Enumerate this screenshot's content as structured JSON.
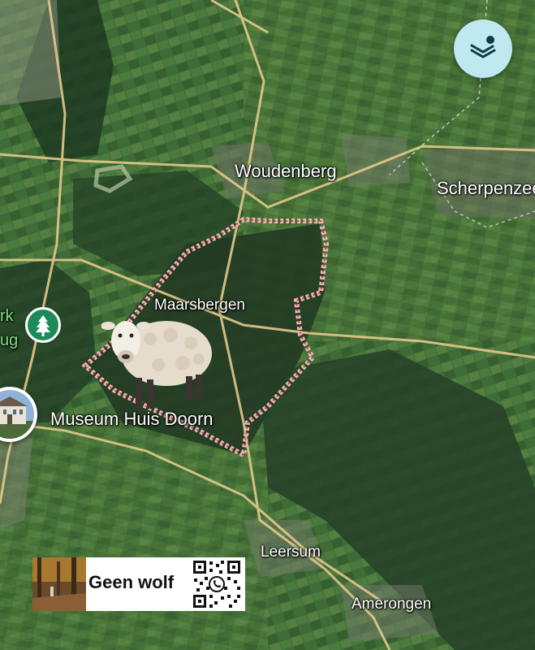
{
  "map": {
    "labels": {
      "woudenberg": "Woudenberg",
      "scherpenzeel": "Scherpenzee",
      "maarsbergen": "Maarsbergen",
      "museum": "Museum Huis Doorn",
      "leersum": "Leersum",
      "amerongen": "Amerongen",
      "park_fragment_1": "rk",
      "park_fragment_2": "ug"
    }
  },
  "overlay": {
    "banner_text": "Geen wolf"
  },
  "controls": {
    "layers_icon": "layers-icon"
  },
  "markers": {
    "park_icon": "tree-icon",
    "museum_icon": "museum-photo"
  },
  "colors": {
    "boundary_outline": "#f2b6b6",
    "road": "#e3c98a",
    "layers_button_bg": "#bfe8f0"
  }
}
